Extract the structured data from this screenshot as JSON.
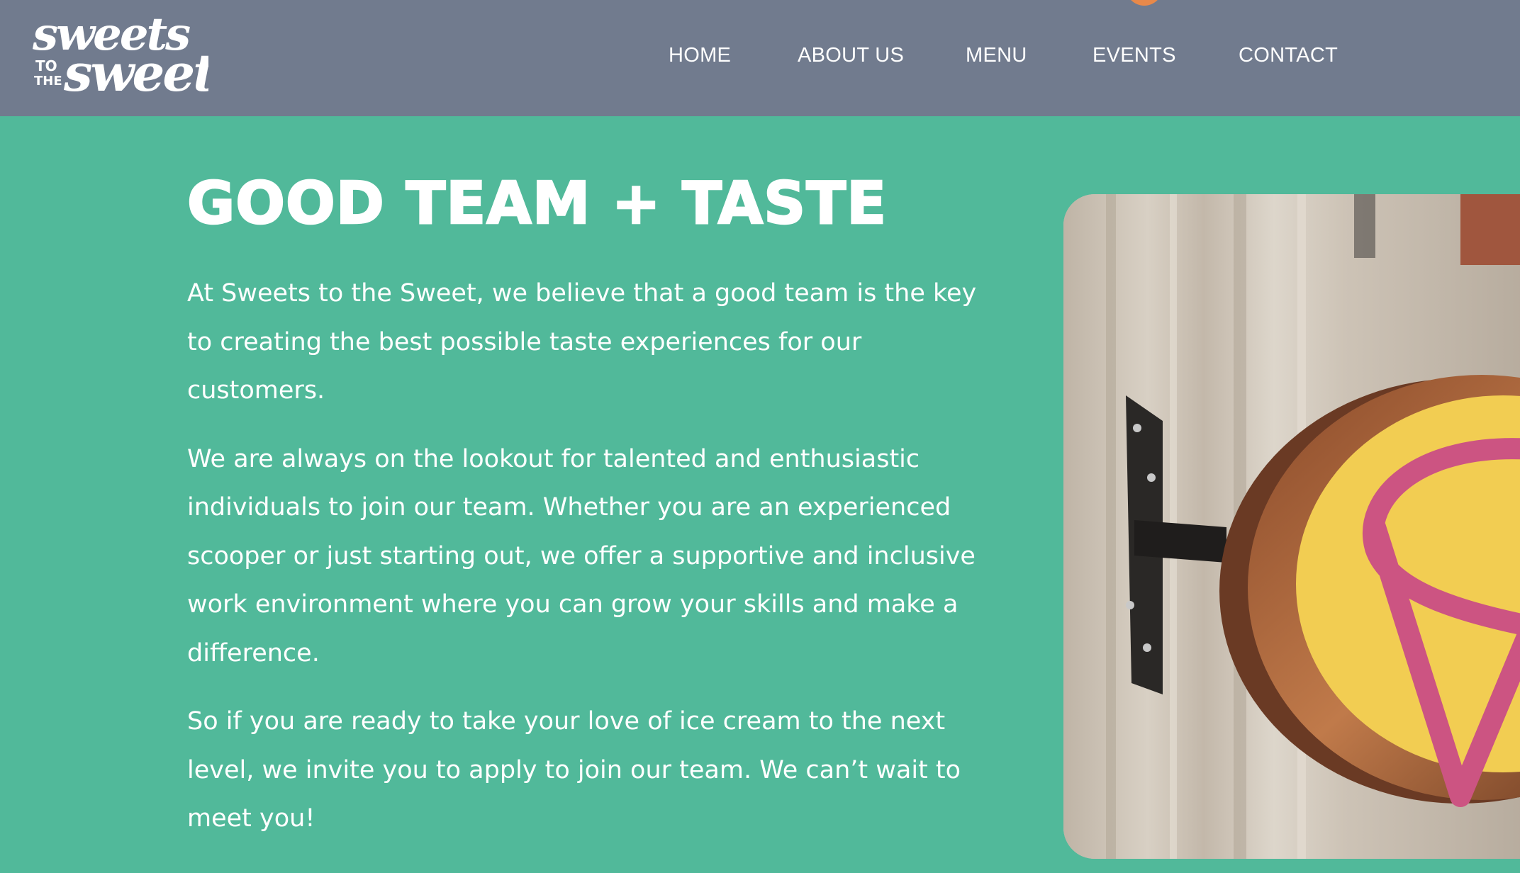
{
  "header": {
    "logo": {
      "line1": "sweets",
      "small1": "TO",
      "small2": "THE",
      "line2": "sweet"
    },
    "nav": [
      {
        "label": "HOME"
      },
      {
        "label": "ABOUT US"
      },
      {
        "label": "MENU"
      },
      {
        "label": "EVENTS"
      },
      {
        "label": "CONTACT"
      }
    ]
  },
  "main": {
    "title": "GOOD TEAM + TASTE",
    "paragraphs": [
      "At Sweets to the Sweet, we believe that a good team is the key to creating the best possible taste experiences for our customers.",
      "We are always on the lookout for talented and enthusiastic individuals to join our team. Whether you are an experienced scooper or just starting out, we offer a supportive and inclusive work environment where you can grow your skills and make a difference.",
      "So if you are ready to take your love of ice cream to the next level, we invite you to apply to join our team. We can’t wait to meet you!"
    ]
  },
  "colors": {
    "header_bg": "#717b8e",
    "page_bg": "#51b99a",
    "text": "#ffffff",
    "accent_orange": "#e8894a",
    "sign_yellow": "#f2cd52",
    "sign_pink": "#cc5482"
  }
}
